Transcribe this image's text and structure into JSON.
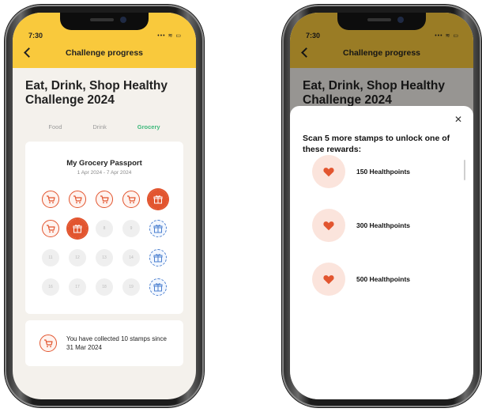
{
  "status": {
    "time": "7:30",
    "icons": "••• ≋ ▭"
  },
  "appbar": {
    "title": "Challenge progress"
  },
  "page": {
    "title": "Eat, Drink, Shop Healthy Challenge 2024"
  },
  "tabs": [
    {
      "label": "Food",
      "active": false
    },
    {
      "label": "Drink",
      "active": false
    },
    {
      "label": "Grocery",
      "active": true
    }
  ],
  "passport": {
    "title": "My Grocery Passport",
    "date_range": "1 Apr 2024 - 7 Apr 2024",
    "stamps": [
      {
        "kind": "cart",
        "label": ""
      },
      {
        "kind": "cart",
        "label": ""
      },
      {
        "kind": "cart",
        "label": ""
      },
      {
        "kind": "cart",
        "label": ""
      },
      {
        "kind": "gift-done",
        "label": ""
      },
      {
        "kind": "cart",
        "label": ""
      },
      {
        "kind": "gift-done",
        "label": ""
      },
      {
        "kind": "empty",
        "label": "8"
      },
      {
        "kind": "empty",
        "label": "9"
      },
      {
        "kind": "gift-todo",
        "label": ""
      },
      {
        "kind": "empty",
        "label": "11"
      },
      {
        "kind": "empty",
        "label": "12"
      },
      {
        "kind": "empty",
        "label": "13"
      },
      {
        "kind": "empty",
        "label": "14"
      },
      {
        "kind": "gift-todo",
        "label": ""
      },
      {
        "kind": "empty",
        "label": "16"
      },
      {
        "kind": "empty",
        "label": "17"
      },
      {
        "kind": "empty",
        "label": "18"
      },
      {
        "kind": "empty",
        "label": "19"
      },
      {
        "kind": "gift-todo",
        "label": ""
      }
    ]
  },
  "summary": {
    "text": "You have collected 10 stamps since 31 Mar 2024"
  },
  "sheet": {
    "heading": "Scan 5 more stamps to unlock one of these rewards:",
    "rewards": [
      {
        "label": "150 Healthpoints"
      },
      {
        "label": "300 Healthpoints"
      },
      {
        "label": "500 Healthpoints"
      }
    ]
  },
  "colors": {
    "accent_yellow": "#f9c93c",
    "stamp_red": "#e2552f",
    "gift_blue": "#4b7fcf",
    "tab_active_green": "#3cb87a"
  },
  "icons": {
    "stamp": "shopping-cart-icon",
    "bonus": "gift-icon",
    "reward": "heart-icon"
  }
}
